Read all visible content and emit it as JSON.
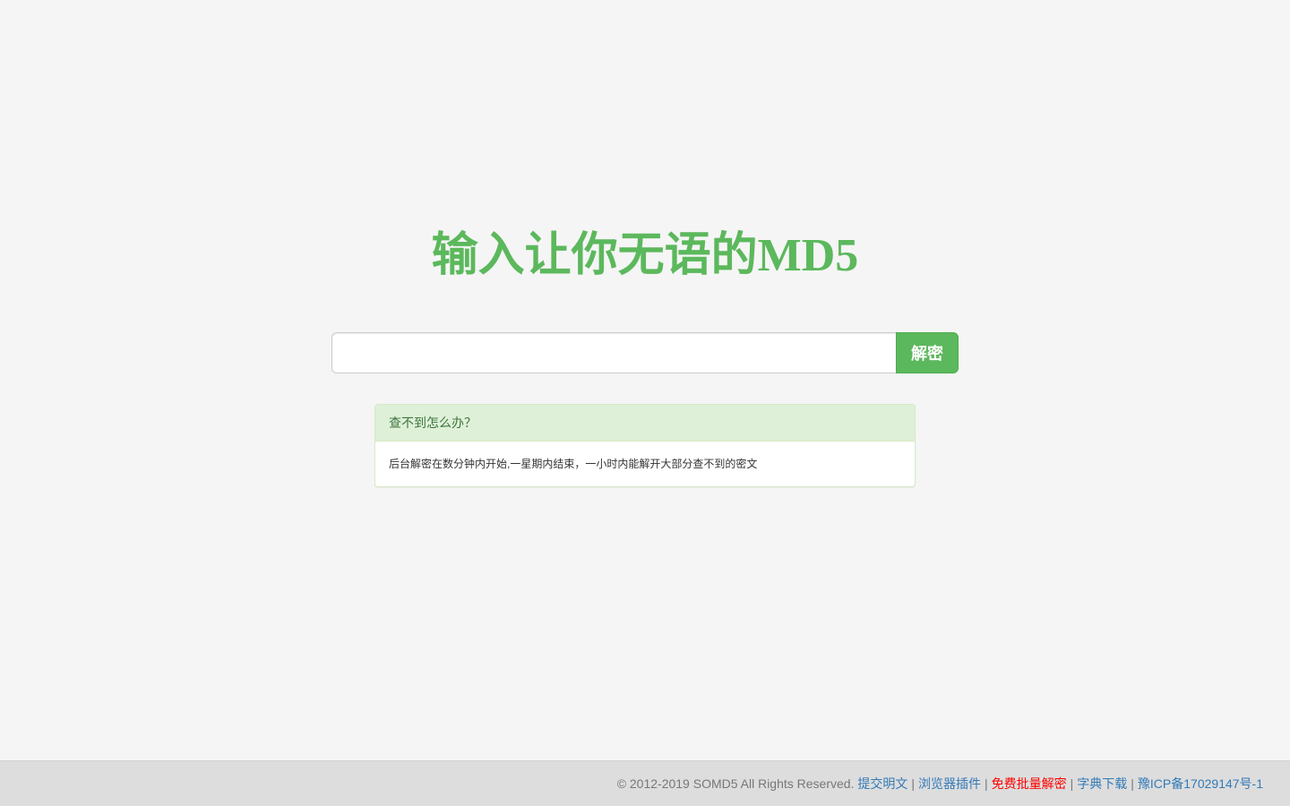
{
  "title": "输入让你无语的MD5",
  "search": {
    "value": "",
    "placeholder": "",
    "button_label": "解密"
  },
  "panel": {
    "heading": "查不到怎么办？",
    "body": "后台解密在数分钟内开始,一星期内结束，一小时内能解开大部分查不到的密文"
  },
  "footer": {
    "copyright": "© 2012-2019 SOMD5 All Rights Reserved. ",
    "links": {
      "submit_plaintext": "提交明文",
      "browser_plugin": "浏览器插件",
      "free_batch_decrypt": "免费批量解密",
      "dictionary_download": "字典下载",
      "icp": "豫ICP备17029147号-1"
    },
    "separator": "|"
  },
  "colors": {
    "brand_green": "#5cb85c",
    "link_blue": "#337ab7",
    "highlight_red": "#ff0000"
  }
}
